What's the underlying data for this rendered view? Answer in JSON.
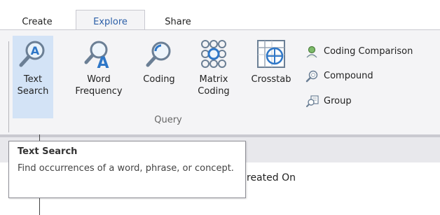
{
  "tabs": [
    {
      "label": "Create",
      "active": false
    },
    {
      "label": "Explore",
      "active": true
    },
    {
      "label": "Share",
      "active": false
    }
  ],
  "ribbon": {
    "query_buttons": [
      {
        "label": "Text\nSearch",
        "icon": "text-search-icon",
        "selected": true
      },
      {
        "label": "Word\nFrequency",
        "icon": "word-frequency-icon",
        "selected": false
      },
      {
        "label": "Coding",
        "icon": "coding-query-icon",
        "selected": false
      },
      {
        "label": "Matrix\nCoding",
        "icon": "matrix-coding-icon",
        "selected": false
      },
      {
        "label": "Crosstab",
        "icon": "crosstab-icon",
        "selected": false
      }
    ],
    "group_label": "Query",
    "small_buttons": [
      {
        "label": "Coding Comparison",
        "icon": "coding-comparison-icon"
      },
      {
        "label": "Compound",
        "icon": "compound-icon"
      },
      {
        "label": "Group",
        "icon": "group-query-icon"
      }
    ]
  },
  "tooltip": {
    "title": "Text Search",
    "description": "Find occurrences of a word, phrase, or concept."
  },
  "list": {
    "column_header_visible": "reated On"
  },
  "colors": {
    "accent_tab_text": "#2c5fa8",
    "selected_bg": "#d3e3f6",
    "ribbon_bg": "#f4f4f6"
  }
}
